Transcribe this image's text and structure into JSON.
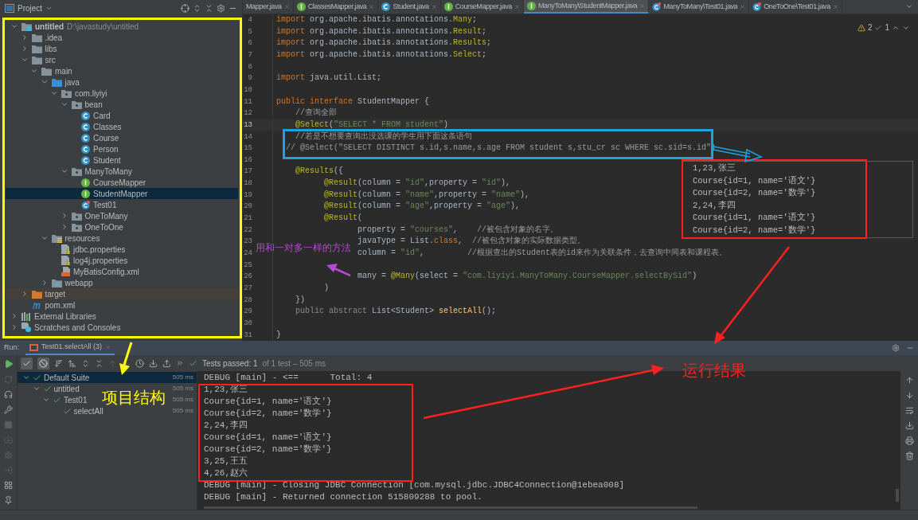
{
  "project_panel": {
    "title": "Project",
    "tree": [
      {
        "label": "untitled",
        "path": "D:\\javastudy\\untitled",
        "kind": "module",
        "expanded": true,
        "selected": false,
        "children": [
          {
            "label": ".idea",
            "kind": "folder",
            "expanded": false,
            "selected": false
          },
          {
            "label": "libs",
            "kind": "folder",
            "expanded": false,
            "selected": false
          },
          {
            "label": "src",
            "kind": "folder",
            "expanded": true,
            "selected": false,
            "children": [
              {
                "label": "main",
                "kind": "folder",
                "expanded": true,
                "selected": false,
                "children": [
                  {
                    "label": "java",
                    "kind": "source_root",
                    "expanded": true,
                    "selected": false,
                    "children": [
                      {
                        "label": "com.liyiyi",
                        "kind": "package",
                        "expanded": true,
                        "selected": false,
                        "children": [
                          {
                            "label": "bean",
                            "kind": "package",
                            "expanded": true,
                            "selected": false,
                            "children": [
                              {
                                "label": "Card",
                                "kind": "class",
                                "selected": false
                              },
                              {
                                "label": "Classes",
                                "kind": "class",
                                "selected": false
                              },
                              {
                                "label": "Course",
                                "kind": "class",
                                "selected": false
                              },
                              {
                                "label": "Person",
                                "kind": "class",
                                "selected": false
                              },
                              {
                                "label": "Student",
                                "kind": "class",
                                "selected": false
                              }
                            ]
                          },
                          {
                            "label": "ManyToMany",
                            "kind": "package",
                            "expanded": true,
                            "selected": false,
                            "children": [
                              {
                                "label": "CourseMapper",
                                "kind": "interface",
                                "selected": false
                              },
                              {
                                "label": "StudentMapper",
                                "kind": "interface",
                                "selected": true
                              },
                              {
                                "label": "Test01",
                                "kind": "test_class",
                                "selected": false
                              }
                            ]
                          },
                          {
                            "label": "OneToMany",
                            "kind": "package",
                            "expanded": false,
                            "selected": false
                          },
                          {
                            "label": "OneToOne",
                            "kind": "package",
                            "expanded": false,
                            "selected": false
                          }
                        ]
                      }
                    ]
                  },
                  {
                    "label": "resources",
                    "kind": "resources_root",
                    "expanded": true,
                    "selected": false,
                    "children": [
                      {
                        "label": "jdbc.properties",
                        "kind": "properties",
                        "selected": false
                      },
                      {
                        "label": "log4j.properties",
                        "kind": "properties",
                        "selected": false
                      },
                      {
                        "label": "MyBatisConfig.xml",
                        "kind": "xml",
                        "selected": false
                      }
                    ]
                  },
                  {
                    "label": "webapp",
                    "kind": "web_folder",
                    "expanded": false,
                    "selected": false
                  }
                ]
              }
            ]
          },
          {
            "label": "target",
            "kind": "excluded",
            "expanded": false,
            "selected": false
          },
          {
            "label": "pom.xml",
            "kind": "pom",
            "selected": false
          }
        ]
      },
      {
        "label": "External Libraries",
        "kind": "libraries",
        "expanded": false,
        "selected": false
      },
      {
        "label": "Scratches and Consoles",
        "kind": "scratches",
        "expanded": false,
        "selected": false
      }
    ]
  },
  "editor": {
    "tabs": [
      {
        "label": "Mapper.java",
        "kind": "partial",
        "selected": false
      },
      {
        "label": "ClassesMapper.java",
        "kind": "interface",
        "selected": false
      },
      {
        "label": "Student.java",
        "kind": "class",
        "selected": false
      },
      {
        "label": "CourseMapper.java",
        "kind": "interface",
        "selected": false
      },
      {
        "label": "ManyToMany\\StudentMapper.java",
        "kind": "interface",
        "selected": true
      },
      {
        "label": "ManyToMany\\Test01.java",
        "kind": "test_class",
        "selected": false
      },
      {
        "label": "OneToOne\\Test01.java",
        "kind": "test_class",
        "selected": false
      }
    ],
    "inspections": {
      "warnings": "2",
      "passes": "1"
    },
    "lines": [
      {
        "number": "4",
        "current": false,
        "tokens": [
          {
            "text": "import",
            "kind": "keyword"
          },
          {
            "text": " org.apache.ibatis.annotations.",
            "kind": "plain"
          },
          {
            "text": "Many",
            "kind": "annotation"
          },
          {
            "text": ";",
            "kind": "plain"
          }
        ]
      },
      {
        "number": "5",
        "current": false,
        "tokens": [
          {
            "text": "import",
            "kind": "keyword"
          },
          {
            "text": " org.apache.ibatis.annotations.",
            "kind": "plain"
          },
          {
            "text": "Result",
            "kind": "annotation"
          },
          {
            "text": ";",
            "kind": "plain"
          }
        ]
      },
      {
        "number": "6",
        "current": false,
        "tokens": [
          {
            "text": "import",
            "kind": "keyword"
          },
          {
            "text": " org.apache.ibatis.annotations.",
            "kind": "plain"
          },
          {
            "text": "Results",
            "kind": "annotation"
          },
          {
            "text": ";",
            "kind": "plain"
          }
        ]
      },
      {
        "number": "7",
        "current": false,
        "tokens": [
          {
            "text": "import",
            "kind": "keyword"
          },
          {
            "text": " org.apache.ibatis.annotations.",
            "kind": "plain"
          },
          {
            "text": "Select",
            "kind": "annotation"
          },
          {
            "text": ";",
            "kind": "plain"
          }
        ]
      },
      {
        "number": "8",
        "current": false
      },
      {
        "number": "9",
        "current": false,
        "tokens": [
          {
            "text": "import",
            "kind": "keyword"
          },
          {
            "text": " java.util.List;",
            "kind": "plain"
          }
        ]
      },
      {
        "number": "10",
        "current": false
      },
      {
        "number": "11",
        "current": false,
        "tokens": [
          {
            "text": "public interface",
            "kind": "keyword"
          },
          {
            "text": " StudentMapper {",
            "kind": "plain"
          }
        ]
      },
      {
        "number": "12",
        "current": false,
        "tokens": [
          {
            "text": "    //查询全部",
            "kind": "comment"
          }
        ]
      },
      {
        "number": "13",
        "current": true,
        "tokens": [
          {
            "text": "    @Select",
            "kind": "annotation"
          },
          {
            "text": "(",
            "kind": "plain"
          },
          {
            "text": "\"SELECT * FROM student\"",
            "kind": "string"
          },
          {
            "text": ")",
            "kind": "plain"
          }
        ]
      },
      {
        "number": "14",
        "current": false,
        "tokens": [
          {
            "text": "    //若是不想要查询出没选课的学生用下面这条语句",
            "kind": "comment"
          }
        ]
      },
      {
        "number": "15",
        "current": false,
        "tokens": [
          {
            "text": "  // @Select(\"SELECT DISTINCT s.id,s.name,s.age FROM student s,stu_cr sc WHERE sc.sid=s.id\")",
            "kind": "comment"
          }
        ]
      },
      {
        "number": "16",
        "current": false
      },
      {
        "number": "17",
        "current": false,
        "tokens": [
          {
            "text": "    @Results",
            "kind": "annotation"
          },
          {
            "text": "({",
            "kind": "plain"
          }
        ]
      },
      {
        "number": "18",
        "current": false,
        "tokens": [
          {
            "text": "          @Result",
            "kind": "annotation"
          },
          {
            "text": "(column = ",
            "kind": "plain"
          },
          {
            "text": "\"id\"",
            "kind": "string"
          },
          {
            "text": ",property = ",
            "kind": "plain"
          },
          {
            "text": "\"id\"",
            "kind": "string"
          },
          {
            "text": "),",
            "kind": "plain"
          }
        ]
      },
      {
        "number": "19",
        "current": false,
        "tokens": [
          {
            "text": "          @Result",
            "kind": "annotation"
          },
          {
            "text": "(column = ",
            "kind": "plain"
          },
          {
            "text": "\"name\"",
            "kind": "string"
          },
          {
            "text": ",property = ",
            "kind": "plain"
          },
          {
            "text": "\"name\"",
            "kind": "string"
          },
          {
            "text": "),",
            "kind": "plain"
          }
        ]
      },
      {
        "number": "20",
        "current": false,
        "tokens": [
          {
            "text": "          @Result",
            "kind": "annotation"
          },
          {
            "text": "(column = ",
            "kind": "plain"
          },
          {
            "text": "\"age\"",
            "kind": "string"
          },
          {
            "text": ",property = ",
            "kind": "plain"
          },
          {
            "text": "\"age\"",
            "kind": "string"
          },
          {
            "text": "),",
            "kind": "plain"
          }
        ]
      },
      {
        "number": "21",
        "current": false,
        "tokens": [
          {
            "text": "          @Result",
            "kind": "annotation"
          },
          {
            "text": "(",
            "kind": "plain"
          }
        ]
      },
      {
        "number": "22",
        "current": false,
        "tokens": [
          {
            "text": "                 property = ",
            "kind": "plain"
          },
          {
            "text": "\"courses\"",
            "kind": "string"
          },
          {
            "text": ",    ",
            "kind": "plain"
          },
          {
            "text": "//被包含对象的名字。",
            "kind": "comment"
          }
        ]
      },
      {
        "number": "23",
        "current": false,
        "tokens": [
          {
            "text": "                 javaType = List.",
            "kind": "plain"
          },
          {
            "text": "class",
            "kind": "keyword"
          },
          {
            "text": ",  ",
            "kind": "plain"
          },
          {
            "text": "//被包含对象的实际数据类型。",
            "kind": "comment"
          }
        ]
      },
      {
        "number": "24",
        "current": false,
        "tokens": [
          {
            "text": "                 column = ",
            "kind": "plain"
          },
          {
            "text": "\"id\"",
            "kind": "string"
          },
          {
            "text": ",         ",
            "kind": "plain"
          },
          {
            "text": "//根据查出的Student表的id来作为关联条件，去查询中间表和课程表。",
            "kind": "comment"
          }
        ]
      },
      {
        "number": "25",
        "current": false
      },
      {
        "number": "26",
        "current": false,
        "tokens": [
          {
            "text": "                 many = ",
            "kind": "plain"
          },
          {
            "text": "@Many",
            "kind": "annotation"
          },
          {
            "text": "(select = ",
            "kind": "plain"
          },
          {
            "text": "\"com.liyiyi.ManyToMany.CourseMapper.selectBySid\"",
            "kind": "string"
          },
          {
            "text": ")",
            "kind": "plain"
          }
        ]
      },
      {
        "number": "27",
        "current": false,
        "tokens": [
          {
            "text": "          )",
            "kind": "plain"
          }
        ]
      },
      {
        "number": "28",
        "current": false,
        "tokens": [
          {
            "text": "    })",
            "kind": "plain"
          }
        ]
      },
      {
        "number": "29",
        "current": false,
        "tokens": [
          {
            "text": "    public abstract",
            "kind": "dimmed"
          },
          {
            "text": " List<Student> ",
            "kind": "plain"
          },
          {
            "text": "selectAll",
            "kind": "method"
          },
          {
            "text": "();",
            "kind": "plain"
          }
        ]
      },
      {
        "number": "30",
        "current": false
      },
      {
        "number": "31",
        "current": false,
        "tokens": [
          {
            "text": "}",
            "kind": "plain"
          }
        ]
      }
    ]
  },
  "output_popup": {
    "lines": [
      "1,23,张三",
      "Course{id=1, name='语文'}",
      "Course{id=2, name='数学'}",
      "2,24,李四",
      "Course{id=1, name='语文'}",
      "Course{id=2, name='数学'}"
    ]
  },
  "run_panel": {
    "label": "Run:",
    "tab": {
      "label": "Test01.selectAll (3)",
      "selected": true
    },
    "status": {
      "passed": "Tests passed: 1",
      "detail": "of 1 test – 505 ms"
    },
    "tests": [
      {
        "label": "Default Suite",
        "time": "505 ms",
        "passed": true,
        "selected": true,
        "expanded": true,
        "children": [
          {
            "label": "untitled",
            "time": "505 ms",
            "passed": true,
            "selected": false,
            "expanded": true,
            "children": [
              {
                "label": "Test01",
                "time": "505 ms",
                "passed": true,
                "selected": false,
                "expanded": true,
                "children": [
                  {
                    "label": "selectAll",
                    "time": "505 ms",
                    "passed": true,
                    "selected": false
                  }
                ]
              }
            ]
          }
        ]
      }
    ],
    "console": [
      "DEBUG [main] - <==      Total: 4",
      "1,23,张三",
      "Course{id=1, name='语文'}",
      "Course{id=2, name='数学'}",
      "2,24,李四",
      "Course{id=1, name='语文'}",
      "Course{id=2, name='数学'}",
      "3,25,王五",
      "4,26,赵六",
      "DEBUG [main] - Closing JDBC Connection [com.mysql.jdbc.JDBC4Connection@1ebea008]",
      "DEBUG [main] - Returned connection 515809288 to pool."
    ]
  },
  "annotations": [
    {
      "text": "用和一对多一样的方法",
      "color": "#b64ad0"
    },
    {
      "text": "项目结构",
      "color": "#ffff00"
    },
    {
      "text": "运行结果",
      "color": "#ff2020"
    }
  ]
}
